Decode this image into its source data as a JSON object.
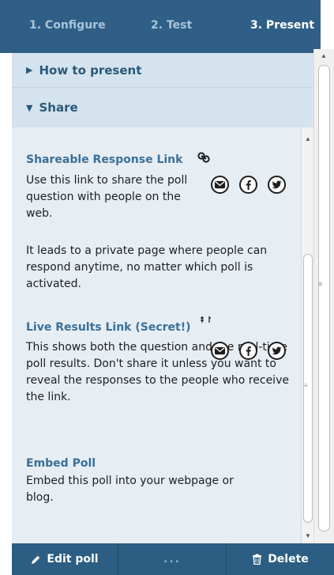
{
  "tabs": [
    {
      "label": "1. Configure"
    },
    {
      "label": "2. Test"
    },
    {
      "label": "3. Present"
    }
  ],
  "sections": {
    "how_to_present": "How to present",
    "share": "Share"
  },
  "shareable": {
    "title": "Shareable Response Link",
    "description": "Use this link to share the poll question with people on the web.",
    "detail": "It leads to a private page where people can respond anytime, no matter which poll is activated.",
    "icons": [
      "link-icon",
      "email-icon",
      "facebook-icon",
      "twitter-icon"
    ]
  },
  "live_results": {
    "title": "Live Results Link (Secret!)",
    "description": "This shows both the question and the real-time poll results. Don't share it unless you want to reveal the responses to the people who receive the link."
  },
  "embed": {
    "title": "Embed Poll",
    "description": "Embed this poll into your webpage or blog."
  },
  "footer": {
    "edit_label": "Edit poll",
    "more_label": "...",
    "delete_label": "Delete"
  },
  "colors": {
    "header_bg": "#2f5f86",
    "section_header_bg": "#d4e3ee",
    "body_bg": "#e6eef4",
    "link_text": "#3a6f98",
    "footer_bg": "#2c5d83"
  }
}
